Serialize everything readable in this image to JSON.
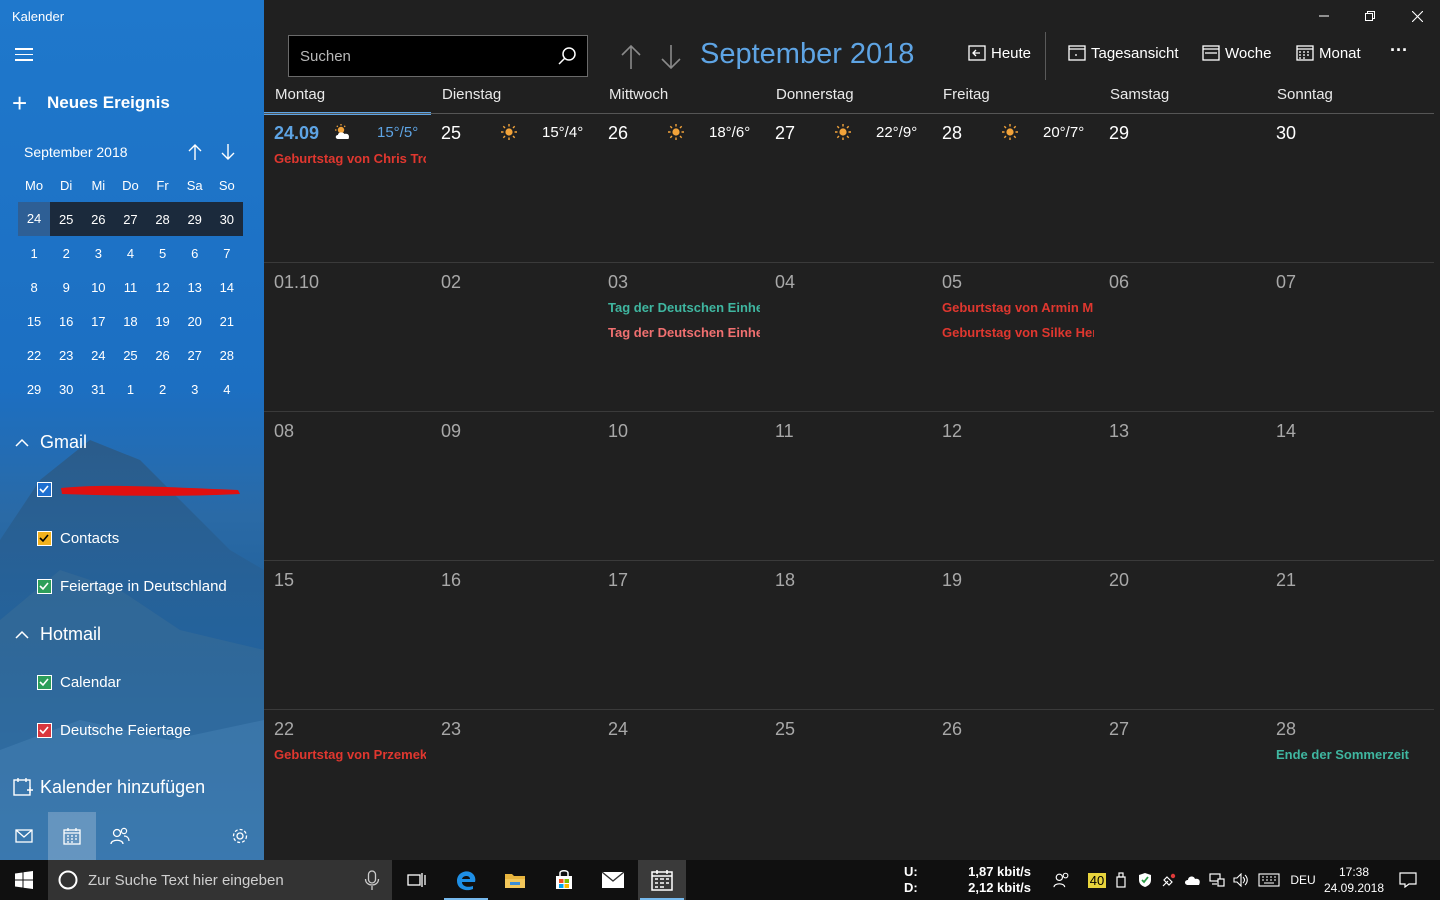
{
  "app": {
    "title": "Kalender"
  },
  "sidebar": {
    "new_event": "Neues Ereignis",
    "mini_month": "September 2018",
    "dow": [
      "Mo",
      "Di",
      "Mi",
      "Do",
      "Fr",
      "Sa",
      "So"
    ],
    "weeks": [
      [
        "24",
        "25",
        "26",
        "27",
        "28",
        "29",
        "30"
      ],
      [
        "1",
        "2",
        "3",
        "4",
        "5",
        "6",
        "7"
      ],
      [
        "8",
        "9",
        "10",
        "11",
        "12",
        "13",
        "14"
      ],
      [
        "15",
        "16",
        "17",
        "18",
        "19",
        "20",
        "21"
      ],
      [
        "22",
        "23",
        "24",
        "25",
        "26",
        "27",
        "28"
      ],
      [
        "29",
        "30",
        "31",
        "1",
        "2",
        "3",
        "4"
      ]
    ],
    "accounts": [
      {
        "name": "Gmail",
        "calendars": [
          {
            "label": "",
            "color": "#1e6fd0",
            "redacted": true
          },
          {
            "label": "Contacts",
            "color": "#f3b21d"
          },
          {
            "label": "Feiertage in Deutschland",
            "color": "#2d9e5a"
          }
        ]
      },
      {
        "name": "Hotmail",
        "calendars": [
          {
            "label": "Calendar",
            "color": "#2d9e5a"
          },
          {
            "label": "Deutsche Feiertage",
            "color": "#d9363e"
          }
        ]
      }
    ],
    "add_calendar": "Kalender hinzufügen"
  },
  "toolbar": {
    "search_placeholder": "Suchen",
    "month_title": "September 2018",
    "today": "Heute",
    "day_view": "Tagesansicht",
    "week": "Woche",
    "month": "Monat",
    "more": "···"
  },
  "calendar": {
    "weekdays": [
      "Montag",
      "Dienstag",
      "Mittwoch",
      "Donnerstag",
      "Freitag",
      "Samstag",
      "Sonntag"
    ],
    "weeks": [
      [
        {
          "num": "24.09",
          "today": true,
          "weather": "15°/5°",
          "weather_icon": "partly-cloudy",
          "events": [
            {
              "text": "Geburtstag von Chris Tro",
              "color": "#e0372f"
            }
          ]
        },
        {
          "num": "25",
          "weather": "15°/4°",
          "weather_icon": "sun"
        },
        {
          "num": "26",
          "weather": "18°/6°",
          "weather_icon": "sun"
        },
        {
          "num": "27",
          "weather": "22°/9°",
          "weather_icon": "sun"
        },
        {
          "num": "28",
          "weather": "20°/7°",
          "weather_icon": "sun"
        },
        {
          "num": "29"
        },
        {
          "num": "30"
        }
      ],
      [
        {
          "num": "01.10",
          "dim": true
        },
        {
          "num": "02",
          "dim": true
        },
        {
          "num": "03",
          "dim": true,
          "events": [
            {
              "text": "Tag der Deutschen Einhei",
              "color": "#3fb6a0"
            },
            {
              "text": "Tag der Deutschen Einhei",
              "color": "#f07070"
            }
          ]
        },
        {
          "num": "04",
          "dim": true
        },
        {
          "num": "05",
          "dim": true,
          "events": [
            {
              "text": "Geburtstag von Armin M",
              "color": "#e0372f"
            },
            {
              "text": "Geburtstag von Silke Her",
              "color": "#e0372f"
            }
          ]
        },
        {
          "num": "06",
          "dim": true
        },
        {
          "num": "07",
          "dim": true
        }
      ],
      [
        {
          "num": "08",
          "dim": true
        },
        {
          "num": "09",
          "dim": true
        },
        {
          "num": "10",
          "dim": true
        },
        {
          "num": "11",
          "dim": true
        },
        {
          "num": "12",
          "dim": true
        },
        {
          "num": "13",
          "dim": true
        },
        {
          "num": "14",
          "dim": true
        }
      ],
      [
        {
          "num": "15",
          "dim": true
        },
        {
          "num": "16",
          "dim": true
        },
        {
          "num": "17",
          "dim": true
        },
        {
          "num": "18",
          "dim": true
        },
        {
          "num": "19",
          "dim": true
        },
        {
          "num": "20",
          "dim": true
        },
        {
          "num": "21",
          "dim": true
        }
      ],
      [
        {
          "num": "22",
          "dim": true,
          "events": [
            {
              "text": "Geburtstag von Przemek",
              "color": "#e0372f"
            }
          ]
        },
        {
          "num": "23",
          "dim": true
        },
        {
          "num": "24",
          "dim": true
        },
        {
          "num": "25",
          "dim": true
        },
        {
          "num": "26",
          "dim": true
        },
        {
          "num": "27",
          "dim": true
        },
        {
          "num": "28",
          "dim": true,
          "events": [
            {
              "text": "Ende der Sommerzeit",
              "color": "#3fb6a0"
            }
          ]
        }
      ]
    ]
  },
  "taskbar": {
    "search_placeholder": "Zur Suche Text hier eingeben",
    "net_up_label": "U:",
    "net_down_label": "D:",
    "net_up": "1,87 kbit/s",
    "net_down": "2,12 kbit/s",
    "badge": "40",
    "language": "DEU",
    "time": "17:38",
    "date": "24.09.2018"
  }
}
